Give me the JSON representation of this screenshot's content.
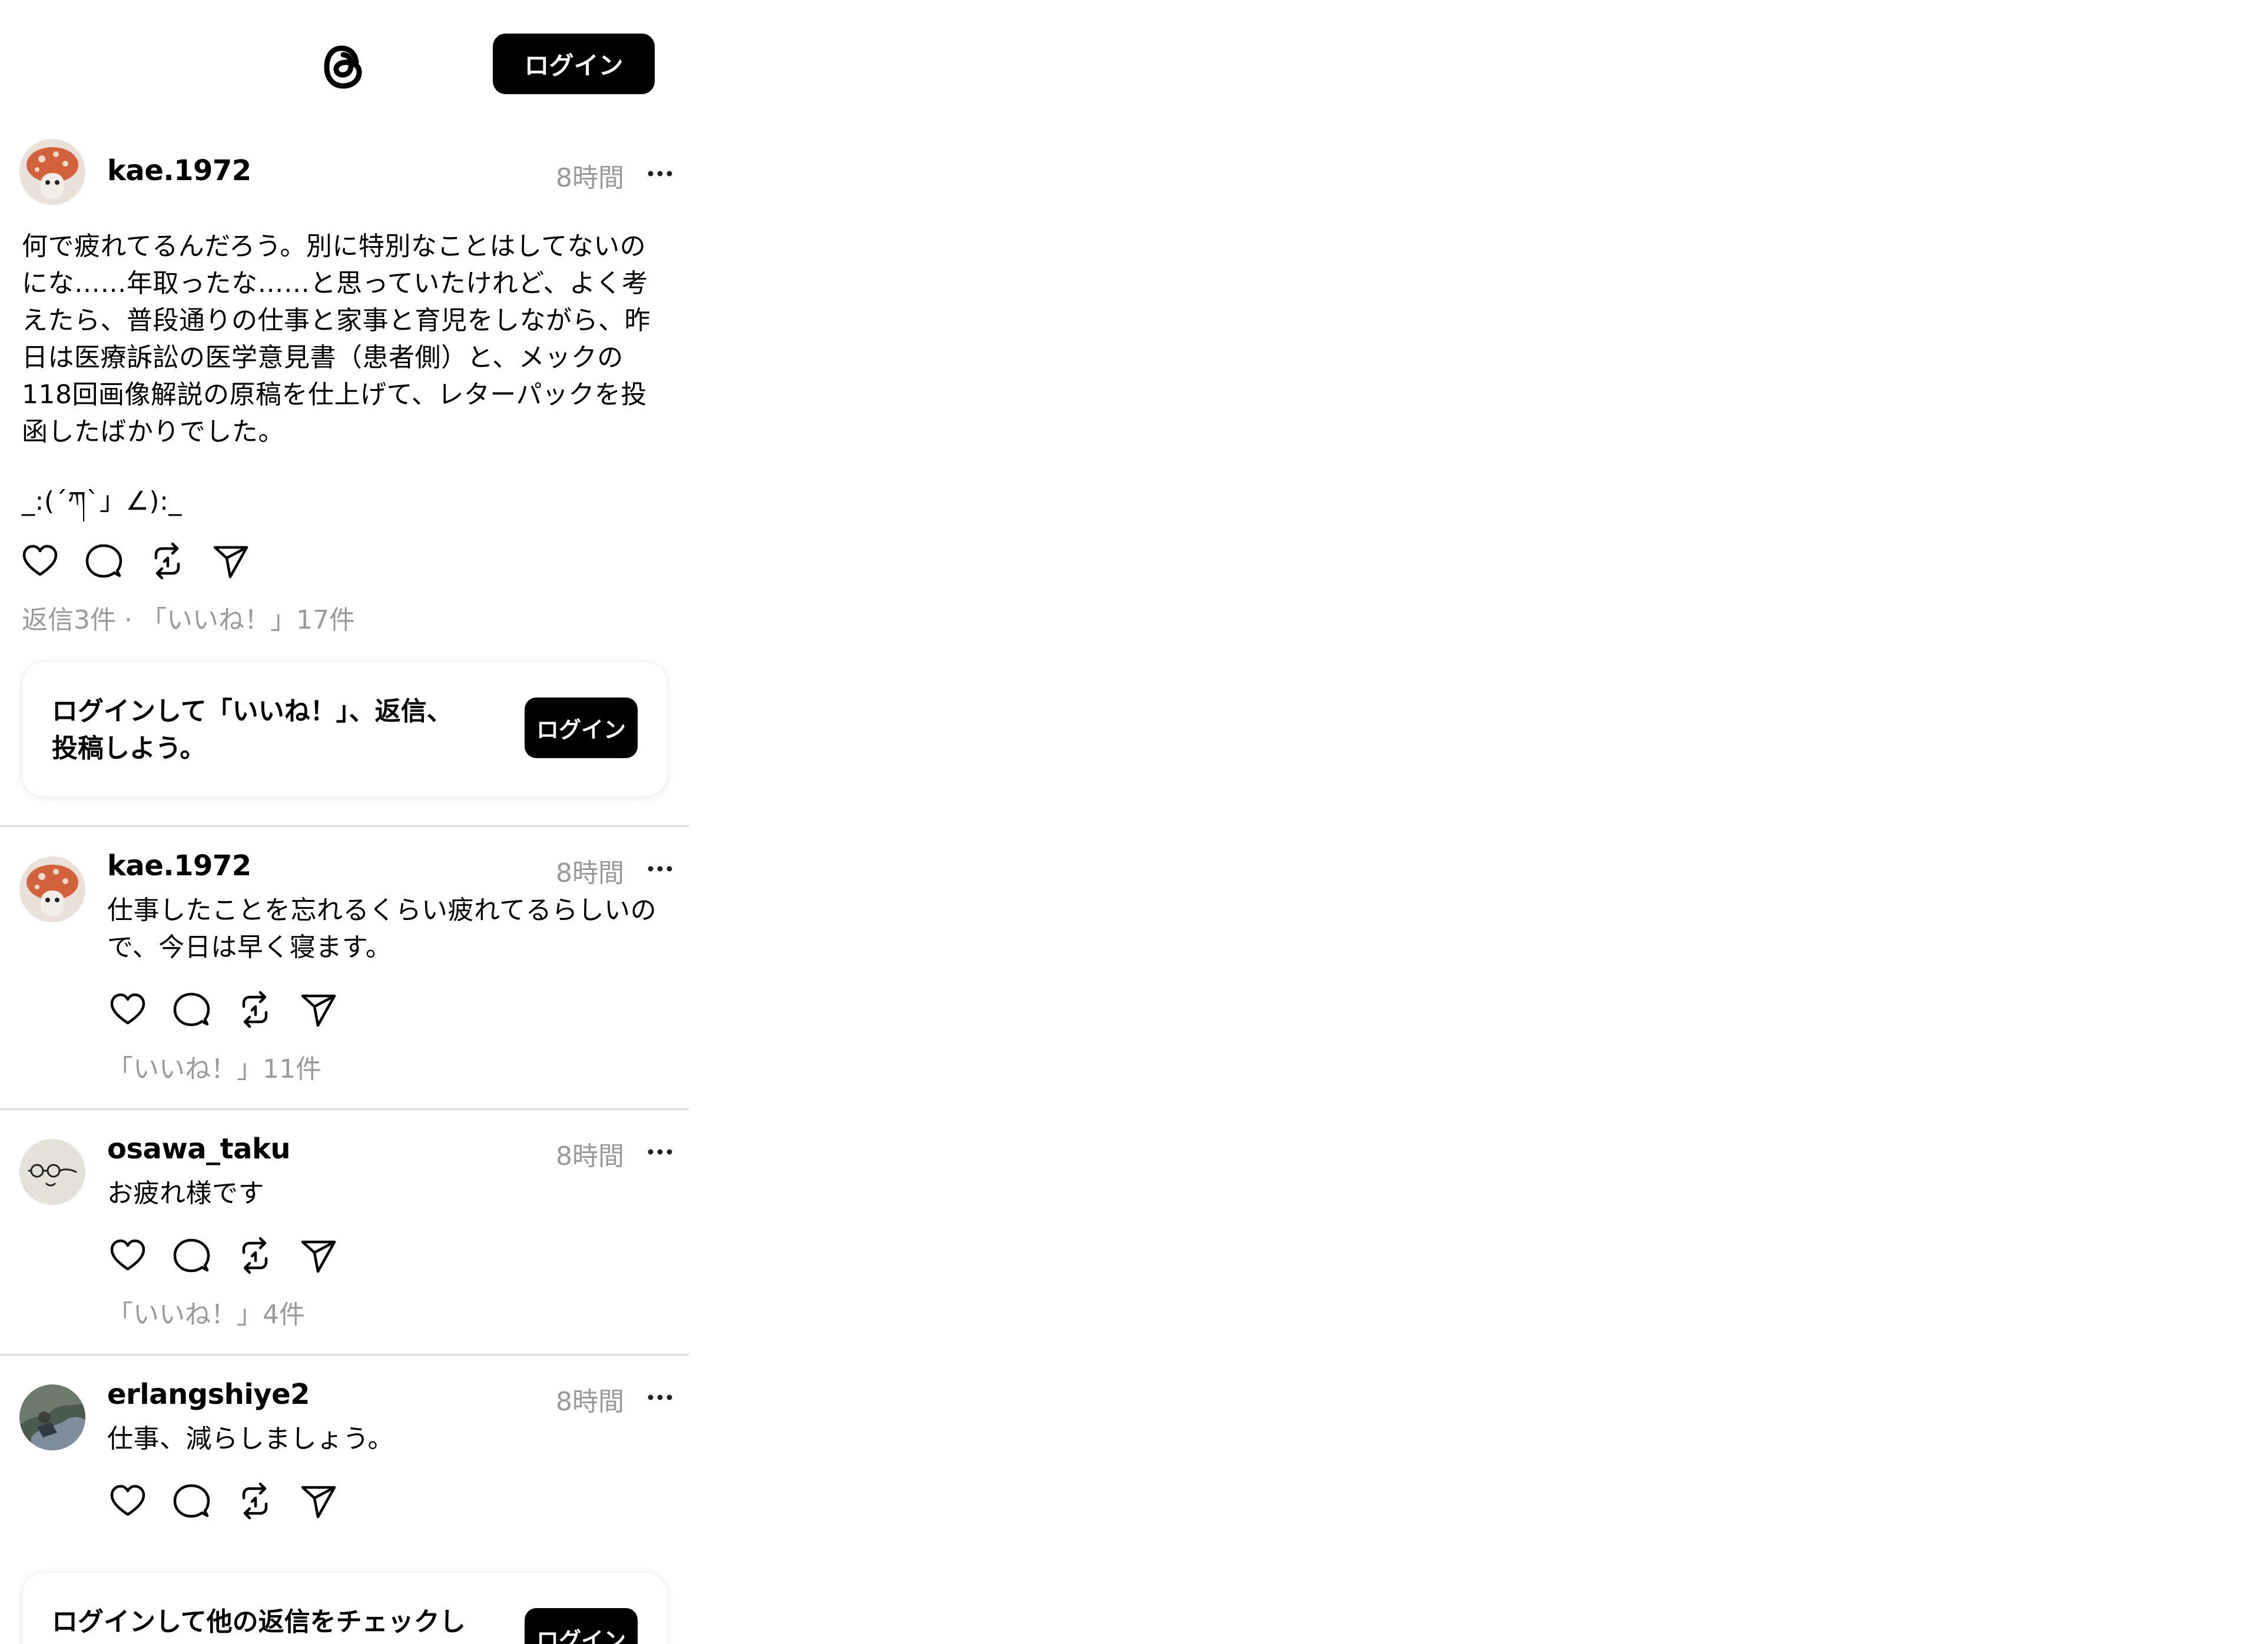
{
  "header": {
    "login_label": "ログイン"
  },
  "main_post": {
    "username": "kae.1972",
    "time": "8時間",
    "text": "何で疲れてるんだろう。別に特別なことはしてないの\nにな……年取ったな……と思っていたけれど、よく考\nえたら、普段通りの仕事と家事と育児をしながら、昨\n日は医療訴訟の医学意見書（患者側）と、メックの\n118回画像解説の原稿を仕上げて、レターパックを投\n函したばかりでした。",
    "emoticon": "_:(´ཀ`」∠):_",
    "stats": "返信3件 · 「いいね！」17件"
  },
  "cta_top": {
    "text": "ログインして「いいね！」、返信、\n投稿しよう。",
    "button": "ログイン"
  },
  "replies": [
    {
      "username": "kae.1972",
      "time": "8時間",
      "text": "仕事したことを忘れるくらい疲れてるらしいの\nで、今日は早く寝ます。",
      "stats": "「いいね！」11件"
    },
    {
      "username": "osawa_taku",
      "time": "8時間",
      "text": "お疲れ様です",
      "stats": "「いいね！」4件"
    },
    {
      "username": "erlangshiye2",
      "time": "8時間",
      "text": "仕事、減らしましょう。",
      "stats": ""
    }
  ],
  "cta_bottom": {
    "text": "ログインして他の返信をチェックし",
    "button": "ログイン"
  },
  "icons": {
    "logo": "threads-logo-icon",
    "like": "heart-icon",
    "reply": "comment-icon",
    "repost": "repost-icon",
    "share": "send-icon",
    "more": "more-dots-icon"
  }
}
